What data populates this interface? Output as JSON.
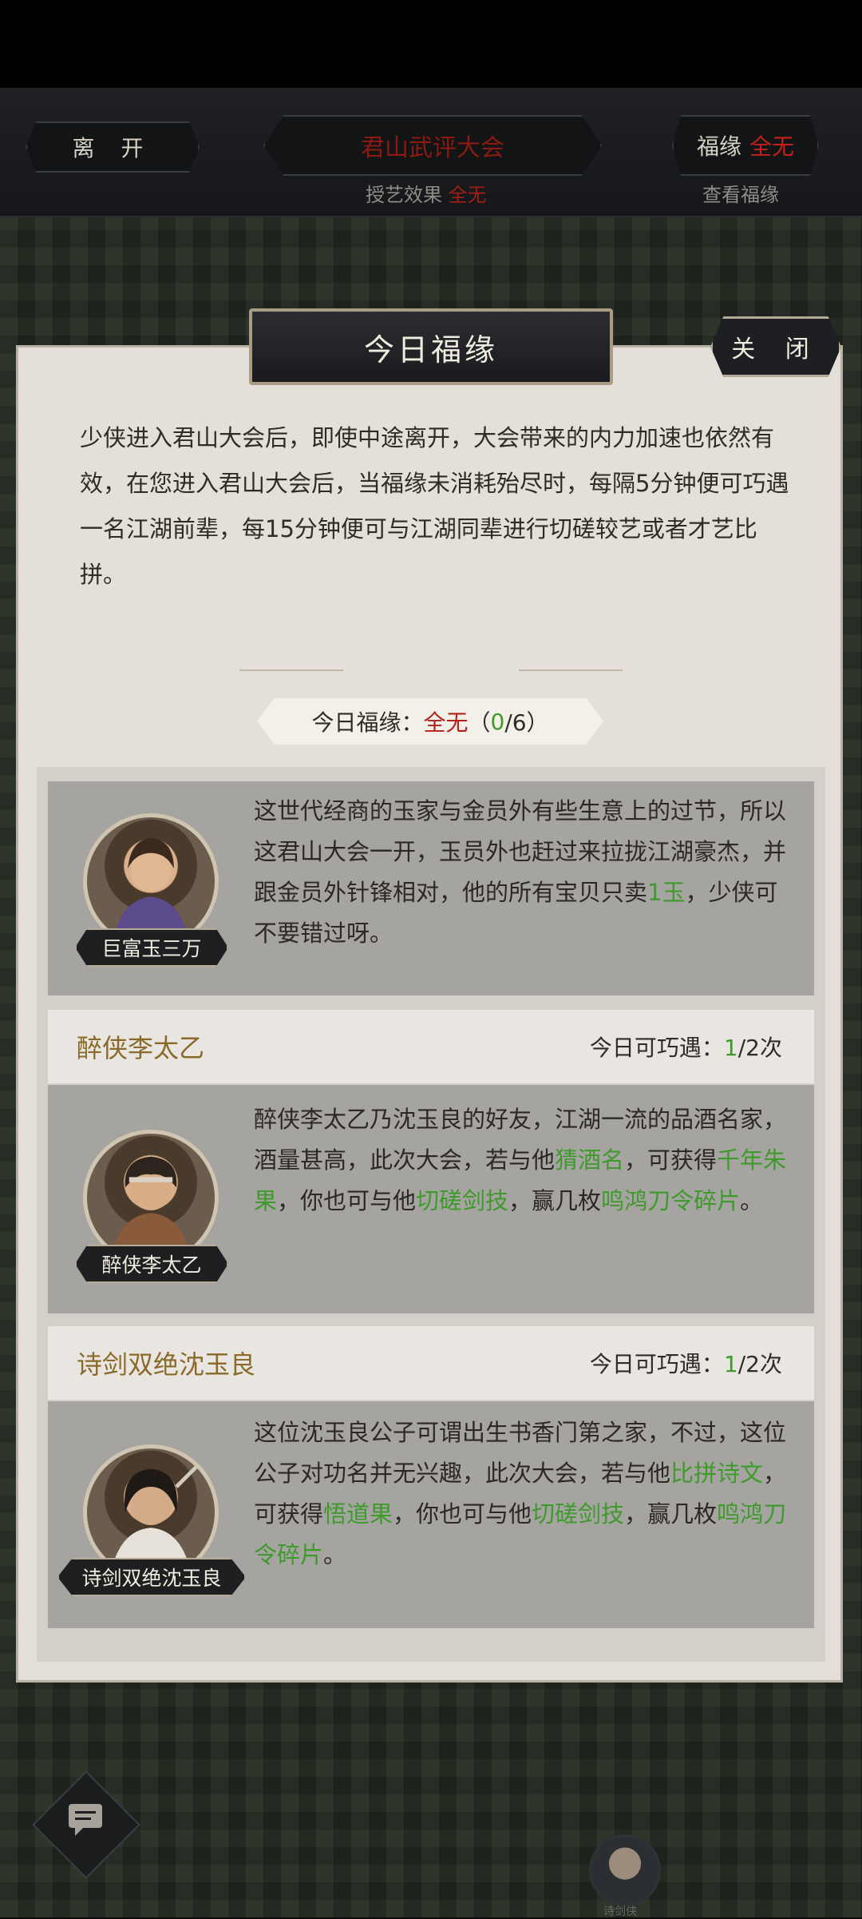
{
  "topbar": {
    "leave_label": "离 开",
    "event_title": "君山武评大会",
    "fortune_label": "福缘",
    "fortune_value": "全无",
    "teach_effect_label": "授艺效果",
    "teach_effect_value": "全无",
    "view_fortune_label": "查看福缘"
  },
  "panel": {
    "title": "今日福缘",
    "close_label": "关 闭",
    "description": "少侠进入君山大会后，即使中途离开，大会带来的内力加速也依然有效，在您进入君山大会后，当福缘未消耗殆尽时，每隔5分钟便可巧遇一名江湖前辈，每15分钟便可与江湖同辈进行切磋较艺或者才艺比拼。",
    "fortune_count": {
      "label": "今日福缘：",
      "value": "全无",
      "paren_open": "（",
      "current": "0",
      "rest": "/6）"
    }
  },
  "npcs": [
    {
      "name": "巨富玉三万",
      "text_parts": [
        "这世代经商的玉家与金员外有些生意上的过节，所以这君山大会一开，玉员外也赶过来拉拢江湖豪杰，并跟金员外针锋相对，他的所有宝贝只卖",
        "1玉",
        "，少侠可不要错过呀。"
      ]
    },
    {
      "name": "醉侠李太乙",
      "meet_label": "今日可巧遇：",
      "meet_current": "1",
      "meet_rest": "/2次",
      "text_parts": [
        "醉侠李太乙乃沈玉良的好友，江湖一流的品酒名家，酒量甚高，此次大会，若与他",
        "猜酒名",
        "，可获得",
        "千年朱果",
        "，你也可与他",
        "切磋剑技",
        "，赢几枚",
        "鸣鸿刀令碎片",
        "。"
      ]
    },
    {
      "name": "诗剑双绝沈玉良",
      "meet_label": "今日可巧遇：",
      "meet_current": "1",
      "meet_rest": "/2次",
      "text_parts": [
        "这位沈玉良公子可谓出生书香门第之家，不过，这位公子对功名并无兴趣，此次大会，若与他",
        "比拼诗文",
        "，可获得",
        "悟道果",
        "，你也可与他",
        "切磋剑技",
        "，赢几枚",
        "鸣鸿刀令碎片",
        "。"
      ]
    }
  ],
  "bottom": {
    "mini_avatar_label": "诗剑侠"
  }
}
